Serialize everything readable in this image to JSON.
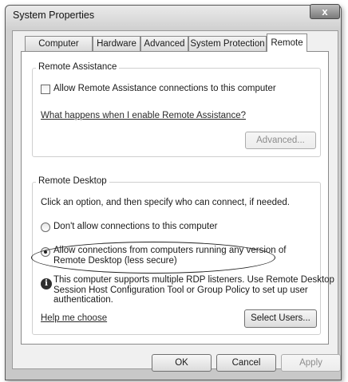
{
  "window": {
    "title": "System Properties",
    "close_glyph": "x"
  },
  "tabs": [
    {
      "label": "Computer Name",
      "active": false
    },
    {
      "label": "Hardware",
      "active": false
    },
    {
      "label": "Advanced",
      "active": false
    },
    {
      "label": "System Protection",
      "active": false
    },
    {
      "label": "Remote",
      "active": true
    }
  ],
  "remote_assistance": {
    "legend": "Remote Assistance",
    "allow_checkbox_label": "Allow Remote Assistance connections to this computer",
    "allow_checked": false,
    "help_link": "What happens when I enable Remote Assistance?",
    "advanced_button": "Advanced..."
  },
  "remote_desktop": {
    "legend": "Remote Desktop",
    "instruction": "Click an option, and then specify who can connect, if needed.",
    "option_dont_allow": "Don't allow connections to this computer",
    "option_allow_any_line1": "Allow connections from computers running any version of",
    "option_allow_any_line2": "Remote Desktop (less secure)",
    "selected_option": "allow_any",
    "info_line1": "This computer supports multiple RDP listeners. Use Remote Desktop",
    "info_line2": "Session Host Configuration Tool or Group Policy to set up user",
    "info_line3": "authentication.",
    "help_link": "Help me choose",
    "select_users_button": "Select Users..."
  },
  "footer": {
    "ok": "OK",
    "cancel": "Cancel",
    "apply": "Apply"
  },
  "icons": {
    "info": "info-icon",
    "close": "close-icon"
  }
}
